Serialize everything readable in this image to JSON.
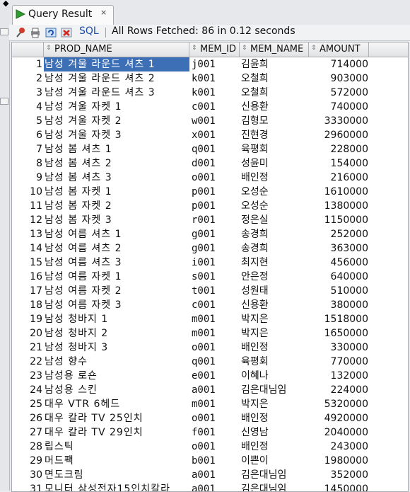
{
  "tab": {
    "title": "Query Result",
    "close": "×"
  },
  "toolbar": {
    "sql_label": "SQL",
    "status": "All Rows Fetched: 86 in 0.12 seconds"
  },
  "grid": {
    "columns": [
      "PROD_NAME",
      "MEM_ID",
      "MEM_NAME",
      "AMOUNT"
    ],
    "sort_glyph": "⇕",
    "rows": [
      {
        "n": "1",
        "prod": "남성 겨울 라운드 셔츠 1",
        "id": "j001",
        "name": "김윤희",
        "amount": "714000"
      },
      {
        "n": "2",
        "prod": "남성 겨울 라운드 셔츠 2",
        "id": "k001",
        "name": "오철희",
        "amount": "903000"
      },
      {
        "n": "3",
        "prod": "남성 겨울 라운드 셔츠 3",
        "id": "k001",
        "name": "오철희",
        "amount": "572000"
      },
      {
        "n": "4",
        "prod": "남성 겨울 자켓 1",
        "id": "c001",
        "name": "신용환",
        "amount": "740000"
      },
      {
        "n": "5",
        "prod": "남성 겨울 자켓 2",
        "id": "w001",
        "name": "김형모",
        "amount": "3330000"
      },
      {
        "n": "6",
        "prod": "남성 겨울 자켓 3",
        "id": "x001",
        "name": "진현경",
        "amount": "2960000"
      },
      {
        "n": "7",
        "prod": "남성 봄 셔츠 1",
        "id": "q001",
        "name": "육평회",
        "amount": "228000"
      },
      {
        "n": "8",
        "prod": "남성 봄 셔츠 2",
        "id": "d001",
        "name": "성윤미",
        "amount": "154000"
      },
      {
        "n": "9",
        "prod": "남성 봄 셔츠 3",
        "id": "o001",
        "name": "배인정",
        "amount": "216000"
      },
      {
        "n": "10",
        "prod": "남성 봄 자켓 1",
        "id": "p001",
        "name": "오성순",
        "amount": "1610000"
      },
      {
        "n": "11",
        "prod": "남성 봄 자켓 2",
        "id": "p001",
        "name": "오성순",
        "amount": "1380000"
      },
      {
        "n": "12",
        "prod": "남성 봄 자켓 3",
        "id": "r001",
        "name": "정은실",
        "amount": "1150000"
      },
      {
        "n": "13",
        "prod": "남성 여름 셔츠 1",
        "id": "g001",
        "name": "송경희",
        "amount": "252000"
      },
      {
        "n": "14",
        "prod": "남성 여름 셔츠 2",
        "id": "g001",
        "name": "송경희",
        "amount": "363000"
      },
      {
        "n": "15",
        "prod": "남성 여름 셔츠 3",
        "id": "i001",
        "name": "최지현",
        "amount": "456000"
      },
      {
        "n": "16",
        "prod": "남성 여름 자켓 1",
        "id": "s001",
        "name": "안은정",
        "amount": "640000"
      },
      {
        "n": "17",
        "prod": "남성 여름 자켓 2",
        "id": "t001",
        "name": "성원태",
        "amount": "510000"
      },
      {
        "n": "18",
        "prod": "남성 여름 자켓 3",
        "id": "c001",
        "name": "신용환",
        "amount": "380000"
      },
      {
        "n": "19",
        "prod": "남성 청바지 1",
        "id": "m001",
        "name": "박지은",
        "amount": "1518000"
      },
      {
        "n": "20",
        "prod": "남성 청바지 2",
        "id": "m001",
        "name": "박지은",
        "amount": "1650000"
      },
      {
        "n": "21",
        "prod": "남성 청바지 3",
        "id": "o001",
        "name": "배인정",
        "amount": "330000"
      },
      {
        "n": "22",
        "prod": "남성 향수",
        "id": "q001",
        "name": "육평회",
        "amount": "770000"
      },
      {
        "n": "23",
        "prod": "남성용 로숀",
        "id": "e001",
        "name": "이혜나",
        "amount": "132000"
      },
      {
        "n": "24",
        "prod": "남성용 스킨",
        "id": "a001",
        "name": "김은대님임",
        "amount": "224000"
      },
      {
        "n": "25",
        "prod": "대우 VTR 6헤드",
        "id": "m001",
        "name": "박지은",
        "amount": "5320000"
      },
      {
        "n": "26",
        "prod": "대우 칼라 TV 25인치",
        "id": "o001",
        "name": "배인정",
        "amount": "4920000"
      },
      {
        "n": "27",
        "prod": "대우 칼라 TV 29인치",
        "id": "f001",
        "name": "신영남",
        "amount": "2040000"
      },
      {
        "n": "28",
        "prod": "립스틱",
        "id": "o001",
        "name": "배인정",
        "amount": "243000"
      },
      {
        "n": "29",
        "prod": "머드팩",
        "id": "b001",
        "name": "이쁜이",
        "amount": "1980000"
      },
      {
        "n": "30",
        "prod": "면도크림",
        "id": "a001",
        "name": "김은대님임",
        "amount": "352000"
      },
      {
        "n": "31",
        "prod": "모니터 삼성전자15인치칼라",
        "id": "a001",
        "name": "김은대님임",
        "amount": "1450000"
      }
    ]
  },
  "colors": {
    "selection": "#3d6fb6",
    "sql_link": "#1c4fa8",
    "play_icon": "#2f9e2f"
  }
}
